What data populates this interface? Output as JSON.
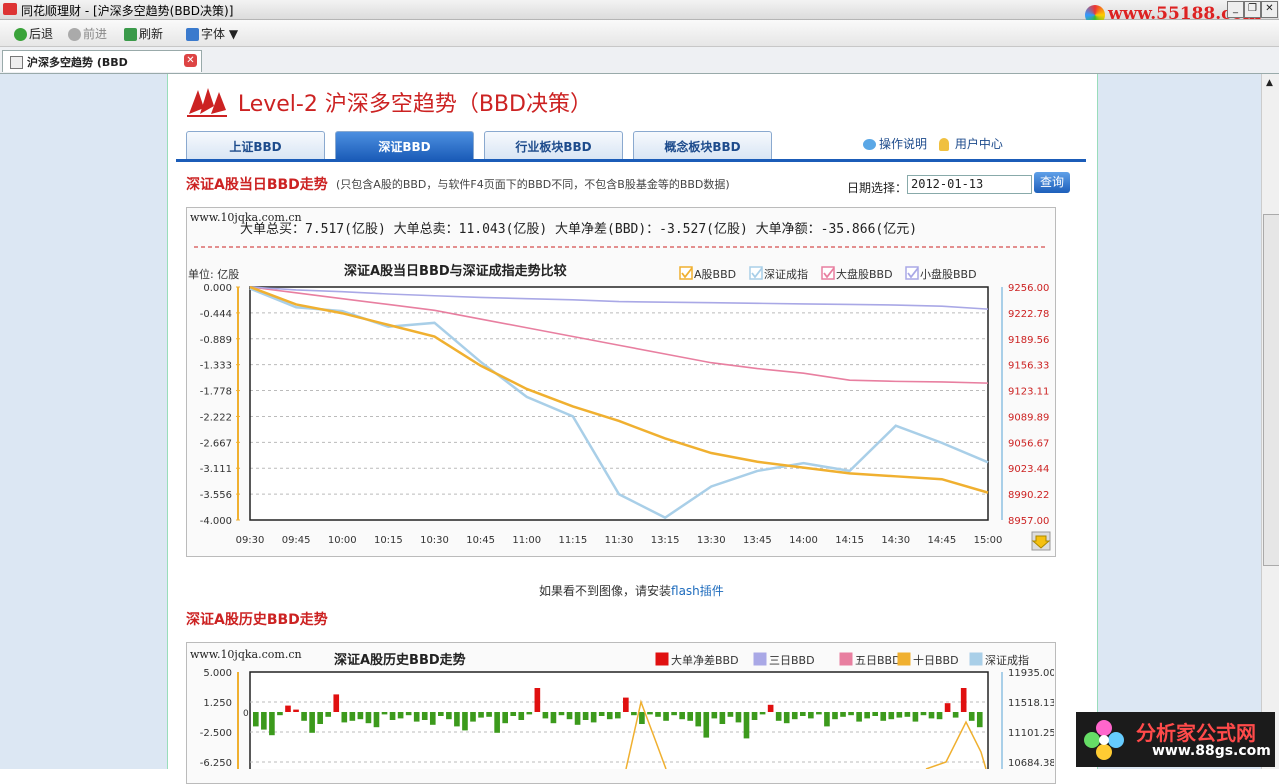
{
  "window": {
    "app": "同花顺理财",
    "title": "同花顺理财 - [沪深多空趋势(BBD决策)]"
  },
  "watermark_top": "www.55188.com",
  "toolbar": {
    "back": "后退",
    "forward": "前进",
    "refresh": "刷新",
    "font": "字体"
  },
  "tab": {
    "label": "沪深多空趋势 (BBD"
  },
  "brand": {
    "title": "Level-2 沪深多空趋势（BBD决策）"
  },
  "nav": {
    "tabs": [
      "上证BBD",
      "深证BBD",
      "行业板块BBD",
      "概念板块BBD"
    ],
    "active": 1,
    "help": "操作说明",
    "user": "用户中心"
  },
  "section1": {
    "title": "深证A股当日BBD走势",
    "note": "(只包含A股的BBD，与软件F4页面下的BBD不同，不包含B股基金等的BBD数据)"
  },
  "date": {
    "label": "日期选择：",
    "value": "2012-01-13",
    "query": "查询"
  },
  "chart_watermark": "www.10jqka.com.cn",
  "stats": {
    "text": "大单总买：7.517(亿股)    大单总卖：11.043(亿股)    大单净差(BBD)：-3.527(亿股)    大单净额：-35.866(亿元)"
  },
  "flash": {
    "prefix": "如果看不到图像，请安装",
    "link": "flash插件"
  },
  "section2": {
    "title": "深证A股历史BBD走势"
  },
  "logo_bottom": {
    "main": "分析家公式网",
    "url": "www.88gs.com"
  },
  "colors": {
    "a_bbd": "#f0b030",
    "index": "#a9cfe8",
    "big": "#e87fa0",
    "small": "#a9a8e6",
    "net": "#e01010",
    "neg": "#3c9a1c"
  },
  "chart_data": [
    {
      "type": "line",
      "title": "深证A股当日BBD与深证成指走势比较",
      "ylabel": "单位: 亿股",
      "x": [
        "09:30",
        "09:45",
        "10:00",
        "10:15",
        "10:30",
        "10:45",
        "11:00",
        "11:15",
        "11:30",
        "13:15",
        "13:30",
        "13:45",
        "14:00",
        "14:15",
        "14:30",
        "14:45",
        "15:00"
      ],
      "ylim": [
        -4.0,
        0.0
      ],
      "yticks_left": [
        "0.000",
        "-0.444",
        "-0.889",
        "-1.333",
        "-1.778",
        "-2.222",
        "-2.667",
        "-3.111",
        "-3.556",
        "-4.000"
      ],
      "yticks_right": [
        "9256.00",
        "9222.78",
        "9189.56",
        "9156.33",
        "9123.11",
        "9089.89",
        "9056.67",
        "9023.44",
        "8990.22",
        "8957.00"
      ],
      "legend": [
        "A股BBD",
        "深证成指",
        "大盘股BBD",
        "小盘股BBD"
      ],
      "series": [
        {
          "name": "A股BBD",
          "values": [
            0.0,
            -0.3,
            -0.45,
            -0.65,
            -0.85,
            -1.35,
            -1.75,
            -2.05,
            -2.3,
            -2.6,
            -2.85,
            -3.0,
            -3.1,
            -3.2,
            -3.25,
            -3.3,
            -3.53
          ]
        },
        {
          "name": "深证成指",
          "values": [
            9254,
            9230,
            9225,
            9205,
            9210,
            9160,
            9115,
            9090,
            8990,
            8960,
            9000,
            9020,
            9030,
            9020,
            9078,
            9056,
            9031
          ]
        },
        {
          "name": "大盘股BBD",
          "values": [
            0.0,
            -0.1,
            -0.2,
            -0.3,
            -0.4,
            -0.55,
            -0.7,
            -0.85,
            -1.0,
            -1.15,
            -1.3,
            -1.4,
            -1.48,
            -1.6,
            -1.62,
            -1.63,
            -1.65
          ]
        },
        {
          "name": "小盘股BBD",
          "values": [
            0.0,
            -0.05,
            -0.08,
            -0.12,
            -0.15,
            -0.18,
            -0.2,
            -0.22,
            -0.25,
            -0.26,
            -0.27,
            -0.28,
            -0.29,
            -0.3,
            -0.31,
            -0.33,
            -0.38
          ]
        }
      ]
    },
    {
      "type": "bar",
      "title": "深证A股历史BBD走势",
      "legend": [
        "大单净差BBD",
        "三日BBD",
        "五日BBD",
        "十日BBD",
        "深证成指"
      ],
      "yticks_left": [
        "5.000",
        "1.250",
        "-2.500",
        "-6.250"
      ],
      "yticks_right": [
        "11935.00",
        "11518.13",
        "11101.25",
        "10684.38"
      ],
      "values": [
        -1.8,
        -2.2,
        -2.9,
        -0.4,
        0.8,
        0.3,
        -1.1,
        -2.6,
        -1.5,
        -0.6,
        2.2,
        -1.3,
        -1.1,
        -0.9,
        -1.4,
        -1.9,
        -0.3,
        -1.0,
        -0.8,
        -0.4,
        -1.2,
        -1.0,
        -1.6,
        -0.5,
        -0.9,
        -1.8,
        -2.3,
        -1.2,
        -0.7,
        -0.6,
        -2.6,
        -1.4,
        -0.5,
        -1.0,
        -0.3,
        3.0,
        -0.8,
        -1.4,
        -0.4,
        -0.9,
        -1.6,
        -1.0,
        -1.3,
        -0.5,
        -0.9,
        -0.8,
        1.8,
        -0.4,
        -1.5,
        -0.3,
        -0.6,
        -1.1,
        -0.4,
        -0.9,
        -1.1,
        -1.8,
        -3.2,
        -0.8,
        -1.5,
        -0.6,
        -1.3,
        -3.3,
        -1.0,
        -0.3,
        0.9,
        -1.1,
        -1.4,
        -0.9,
        -0.5,
        -0.8,
        -0.3,
        -1.8,
        -0.9,
        -0.6,
        -0.4,
        -1.2,
        -0.8,
        -0.5,
        -1.1,
        -0.9,
        -0.7,
        -0.6,
        -1.2,
        -0.4,
        -0.8,
        -0.9,
        1.1,
        -0.7,
        3.0,
        -1.1,
        -1.9
      ]
    }
  ]
}
